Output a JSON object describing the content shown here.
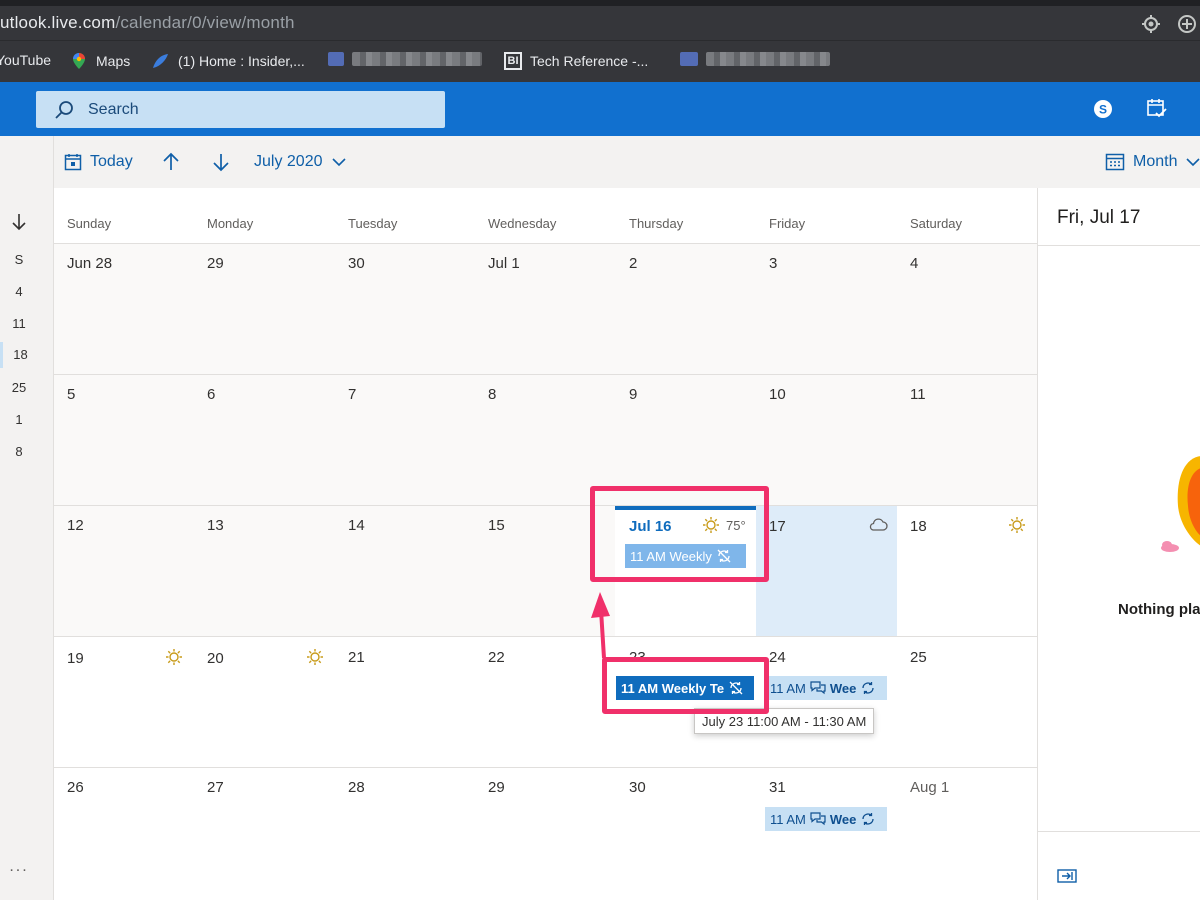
{
  "browser": {
    "url_host": "utlook.live.com",
    "url_path": "/calendar/0/view/month",
    "bookmarks": [
      "YouTube",
      "Maps",
      "(1) Home : Insider,...",
      "Tech Reference -..."
    ],
    "bi_badge": "BI"
  },
  "header": {
    "search_placeholder": "Search"
  },
  "commands": {
    "today": "Today",
    "month_picker": "July 2020",
    "view": "Month"
  },
  "mini_calendar": {
    "dates": [
      "S",
      "4",
      "11",
      "18",
      "25",
      "1",
      "8"
    ],
    "more": "..."
  },
  "weekdays": [
    "Sunday",
    "Monday",
    "Tuesday",
    "Wednesday",
    "Thursday",
    "Friday",
    "Saturday"
  ],
  "weeks": [
    [
      "Jun 28",
      "29",
      "30",
      "Jul 1",
      "2",
      "3",
      "4"
    ],
    [
      "5",
      "6",
      "7",
      "8",
      "9",
      "10",
      "11"
    ],
    [
      "12",
      "13",
      "14",
      "15",
      "Jul 16",
      "17",
      "18"
    ],
    [
      "19",
      "20",
      "21",
      "22",
      "23",
      "24",
      "25"
    ],
    [
      "26",
      "27",
      "28",
      "29",
      "30",
      "31",
      "Aug 1"
    ]
  ],
  "today_weather": "75°",
  "events": {
    "jul16": "11 AM  Weekly",
    "jul23": "11 AM  Weekly Te",
    "jul24": "11 AM",
    "jul24_title": "Wee",
    "jul31": "11 AM",
    "jul31_title": "Wee"
  },
  "tooltip": "July 23 11:00 AM - 11:30 AM",
  "pane": {
    "title": "Fri, Jul 17",
    "empty_text": "Nothing pla"
  },
  "colors": {
    "accent": "#0f6cbd",
    "highlight": "#f0306a",
    "selected_day": "#deecf9"
  }
}
